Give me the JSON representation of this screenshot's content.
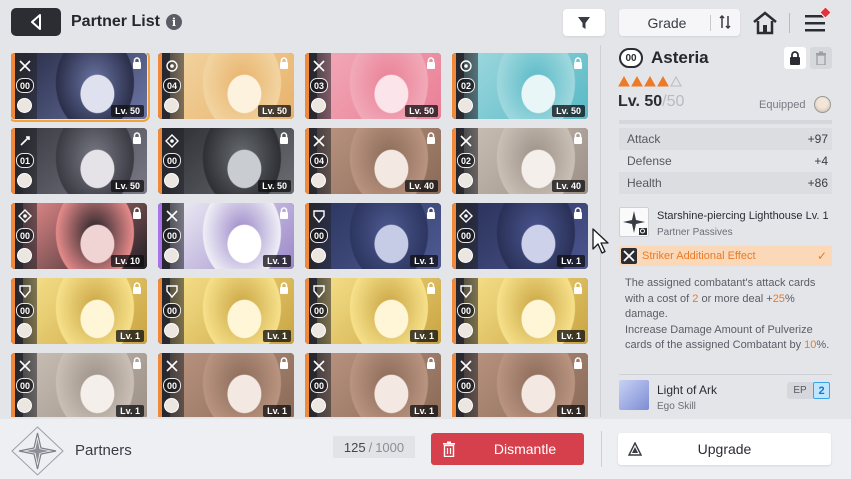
{
  "header": {
    "title": "Partner List",
    "info_symbol": "i",
    "sort_label": "Grade",
    "icons": [
      "back-arrow-icon",
      "info-icon",
      "filter-icon",
      "sort-direction-icon",
      "home-icon",
      "menu-icon"
    ]
  },
  "cards": [
    {
      "cost": "00",
      "level": "Lv. 50",
      "class": "striker",
      "rarity": "orange",
      "selected": true,
      "art": [
        "#2b2f4a",
        "#6c76a6",
        "#dfe1ef"
      ]
    },
    {
      "cost": "04",
      "level": "Lv. 50",
      "class": "support",
      "rarity": "orange",
      "selected": false,
      "art": [
        "#f2d4a1",
        "#e8b26b",
        "#fdf2de"
      ]
    },
    {
      "cost": "03",
      "level": "Lv. 50",
      "class": "striker",
      "rarity": "orange",
      "selected": false,
      "art": [
        "#f1a9b8",
        "#ea7f96",
        "#fbe4ea"
      ]
    },
    {
      "cost": "02",
      "level": "Lv. 50",
      "class": "support",
      "rarity": "orange",
      "selected": false,
      "art": [
        "#9fd8de",
        "#58b9c6",
        "#e8f6f8"
      ]
    },
    {
      "cost": "01",
      "level": "Lv. 50",
      "class": "hunter",
      "rarity": "orange",
      "selected": false,
      "art": [
        "#3b3b44",
        "#7a7a86",
        "#e6e3e8"
      ]
    },
    {
      "cost": "00",
      "level": "Lv. 50",
      "class": "controller",
      "rarity": "orange",
      "selected": false,
      "art": [
        "#2e3034",
        "#6a6d72",
        "#c9ccd1"
      ]
    },
    {
      "cost": "04",
      "level": "Lv. 40",
      "class": "striker",
      "rarity": "orange",
      "selected": false,
      "art": [
        "#b99480",
        "#8a6a58",
        "#f3e9e2"
      ]
    },
    {
      "cost": "02",
      "level": "Lv. 40",
      "class": "striker",
      "rarity": "orange",
      "selected": false,
      "art": [
        "#c9bfb5",
        "#9c9087",
        "#f4efea"
      ]
    },
    {
      "cost": "00",
      "level": "Lv. 10",
      "class": "controller",
      "rarity": "orange",
      "selected": false,
      "art": [
        "#e58a8a",
        "#1f1f24",
        "#f0d4d4"
      ]
    },
    {
      "cost": "00",
      "level": "Lv. 1",
      "class": "striker",
      "rarity": "purple",
      "selected": false,
      "art": [
        "#efeef6",
        "#9a86c8",
        "#ffffff"
      ]
    },
    {
      "cost": "00",
      "level": "Lv. 1",
      "class": "vanguard",
      "rarity": "orange",
      "selected": false,
      "art": [
        "#2d3660",
        "#4e5a92",
        "#c7cce6"
      ]
    },
    {
      "cost": "00",
      "level": "Lv. 1",
      "class": "controller",
      "rarity": "orange",
      "selected": false,
      "art": [
        "#2a3158",
        "#4b5690",
        "#cdd2ea"
      ]
    },
    {
      "cost": "00",
      "level": "Lv. 1",
      "class": "vanguard",
      "rarity": "orange",
      "selected": false,
      "art": [
        "#f6e08a",
        "#c9a442",
        "#fff6d8"
      ]
    },
    {
      "cost": "00",
      "level": "Lv. 1",
      "class": "vanguard",
      "rarity": "orange",
      "selected": false,
      "art": [
        "#f6e08a",
        "#c9a442",
        "#fff6d8"
      ]
    },
    {
      "cost": "00",
      "level": "Lv. 1",
      "class": "vanguard",
      "rarity": "orange",
      "selected": false,
      "art": [
        "#f6e08a",
        "#c9a442",
        "#fff6d8"
      ]
    },
    {
      "cost": "00",
      "level": "Lv. 1",
      "class": "vanguard",
      "rarity": "orange",
      "selected": false,
      "art": [
        "#f6e08a",
        "#c9a442",
        "#fff6d8"
      ]
    },
    {
      "cost": "00",
      "level": "Lv. 1",
      "class": "striker",
      "rarity": "orange",
      "selected": false,
      "art": [
        "#c9bfb5",
        "#9c9087",
        "#f4efea"
      ]
    },
    {
      "cost": "00",
      "level": "Lv. 1",
      "class": "striker",
      "rarity": "orange",
      "selected": false,
      "art": [
        "#b99480",
        "#8a6a58",
        "#f3e9e2"
      ]
    },
    {
      "cost": "00",
      "level": "Lv. 1",
      "class": "striker",
      "rarity": "orange",
      "selected": false,
      "art": [
        "#b99480",
        "#8a6a58",
        "#f3e9e2"
      ]
    },
    {
      "cost": "00",
      "level": "Lv. 1",
      "class": "striker",
      "rarity": "orange",
      "selected": false,
      "art": [
        "#b99480",
        "#8a6a58",
        "#f3e9e2"
      ]
    }
  ],
  "detail": {
    "cost": "00",
    "name": "Asteria",
    "stars_filled": 4,
    "stars_total": 5,
    "level": "Lv. 50",
    "level_max": "50",
    "level_sep": "/",
    "equipped_label": "Equipped",
    "stats": [
      {
        "label": "Attack",
        "value": "+97"
      },
      {
        "label": "Defense",
        "value": "+4"
      },
      {
        "label": "Health",
        "value": "+86"
      }
    ],
    "passive_title": "Starshine-piercing Lighthouse Lv. 1",
    "passive_sub": "Partner Passives",
    "striker_label": "Striker Additional Effect",
    "striker_check": "✓",
    "desc": {
      "p1": "The assigned combatant's attack cards with a cost of ",
      "h1": "2",
      "p2": " or more deal +",
      "h2": "25",
      "p3": "% damage.",
      "p4": "Increase Damage Amount of Pulverize cards of the assigned Combatant by ",
      "h3": "10",
      "p5": "%."
    },
    "ego_title": "Light of Ark",
    "ego_sub": "Ego Skill",
    "ep_label": "EP",
    "ep_value": "2"
  },
  "footer": {
    "label": "Partners",
    "count": "125",
    "count_sep": "/",
    "count_max": "1000",
    "dismantle": "Dismantle",
    "upgrade": "Upgrade"
  },
  "colors": {
    "accent_orange": "#ec7a26",
    "dismantle_red": "#d6404d",
    "selected_outline": "#f3a23a"
  }
}
